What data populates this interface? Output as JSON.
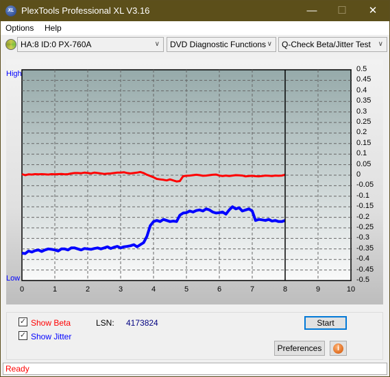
{
  "window": {
    "title": "PlexTools Professional XL V3.16",
    "app_icon_text": "XL"
  },
  "menu": {
    "items": [
      "Options",
      "Help"
    ]
  },
  "toolbar": {
    "drive": "HA:8 ID:0  PX-760A",
    "function": "DVD Diagnostic Functions",
    "test": "Q-Check Beta/Jitter Test"
  },
  "chart_labels": {
    "high": "High",
    "low": "Low"
  },
  "chart_data": {
    "type": "line",
    "xlim": [
      0,
      10
    ],
    "ylim": [
      -0.5,
      0.5
    ],
    "x_ticks": [
      "0",
      "1",
      "2",
      "3",
      "4",
      "5",
      "6",
      "7",
      "8",
      "9",
      "10"
    ],
    "y_ticks": [
      "0.5",
      "0.45",
      "0.4",
      "0.35",
      "0.3",
      "0.25",
      "0.2",
      "0.15",
      "0.1",
      "0.05",
      "0",
      "-0.05",
      "-0.1",
      "-0.15",
      "-0.2",
      "-0.25",
      "-0.3",
      "-0.35",
      "-0.4",
      "-0.45",
      "-0.5"
    ],
    "grid": true,
    "marker_x": 8,
    "x_step": 0.1,
    "series": [
      {
        "key": "beta",
        "color": "#ff0000",
        "values": [
          0.005,
          0.0,
          0.004,
          0.003,
          0.005,
          0.004,
          0.005,
          0.004,
          0.003,
          0.005,
          0.004,
          0.005,
          0.006,
          0.004,
          0.005,
          0.008,
          0.01,
          0.01,
          0.009,
          0.012,
          0.01,
          0.008,
          0.012,
          0.01,
          0.008,
          0.006,
          0.007,
          0.008,
          0.01,
          0.012,
          0.012,
          0.014,
          0.01,
          0.008,
          0.01,
          0.012,
          0.015,
          0.01,
          0.002,
          -0.004,
          -0.01,
          -0.018,
          -0.02,
          -0.022,
          -0.025,
          -0.02,
          -0.025,
          -0.03,
          -0.028,
          -0.005,
          -0.003,
          -0.002,
          0.0,
          0.002,
          0.0,
          -0.003,
          -0.002,
          0.0,
          0.002,
          0.003,
          -0.002,
          -0.004,
          -0.002,
          -0.004,
          -0.002,
          0.0,
          -0.001,
          -0.002,
          -0.006,
          -0.004,
          -0.003,
          -0.005,
          -0.006,
          -0.004,
          -0.002,
          -0.003,
          -0.004,
          -0.002,
          -0.003,
          -0.002,
          0.002
        ]
      },
      {
        "key": "jitter",
        "color": "#0000ff",
        "values": [
          -0.37,
          -0.372,
          -0.36,
          -0.365,
          -0.358,
          -0.355,
          -0.362,
          -0.355,
          -0.35,
          -0.352,
          -0.355,
          -0.36,
          -0.35,
          -0.35,
          -0.355,
          -0.345,
          -0.345,
          -0.35,
          -0.355,
          -0.348,
          -0.35,
          -0.352,
          -0.348,
          -0.345,
          -0.35,
          -0.345,
          -0.34,
          -0.348,
          -0.342,
          -0.338,
          -0.345,
          -0.34,
          -0.338,
          -0.335,
          -0.33,
          -0.34,
          -0.33,
          -0.32,
          -0.29,
          -0.24,
          -0.22,
          -0.215,
          -0.22,
          -0.21,
          -0.215,
          -0.22,
          -0.218,
          -0.22,
          -0.19,
          -0.18,
          -0.178,
          -0.17,
          -0.175,
          -0.168,
          -0.165,
          -0.17,
          -0.16,
          -0.165,
          -0.175,
          -0.18,
          -0.178,
          -0.175,
          -0.185,
          -0.165,
          -0.15,
          -0.16,
          -0.155,
          -0.17,
          -0.165,
          -0.16,
          -0.17,
          -0.215,
          -0.21,
          -0.212,
          -0.215,
          -0.21,
          -0.218,
          -0.215,
          -0.22,
          -0.22,
          -0.215
        ]
      }
    ]
  },
  "options": {
    "show_beta": "Show Beta",
    "show_jitter": "Show Jitter",
    "show_beta_checked": true,
    "show_jitter_checked": true,
    "lsn_label": "LSN:",
    "lsn_value": "4173824"
  },
  "buttons": {
    "start": "Start",
    "preferences": "Preferences"
  },
  "status": "Ready"
}
